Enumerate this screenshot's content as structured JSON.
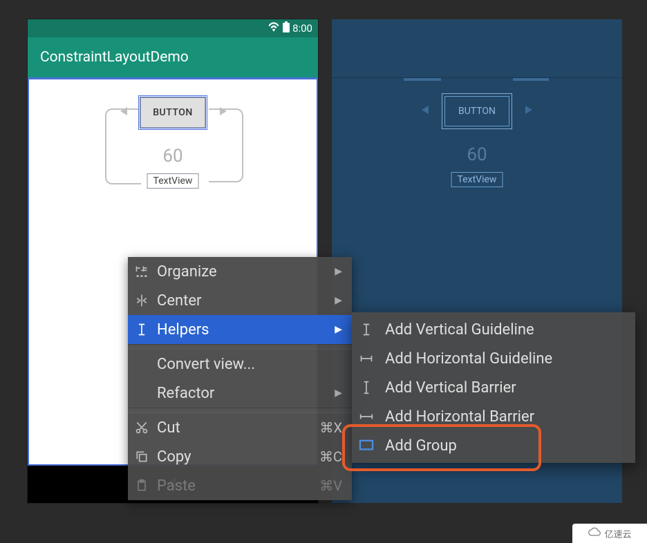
{
  "status": {
    "time": "8:00"
  },
  "app": {
    "title": "ConstraintLayoutDemo"
  },
  "widgets": {
    "button_label": "BUTTON",
    "margin": "60",
    "textview_label": "TextView"
  },
  "menu": {
    "organize": "Organize",
    "center": "Center",
    "helpers": "Helpers",
    "convert": "Convert view...",
    "refactor": "Refactor",
    "cut": "Cut",
    "cut_sc": "⌘X",
    "copy": "Copy",
    "copy_sc": "⌘C",
    "paste": "Paste",
    "paste_sc": "⌘V"
  },
  "submenu": {
    "add_vg": "Add Vertical Guideline",
    "add_hg": "Add Horizontal Guideline",
    "add_vb": "Add Vertical Barrier",
    "add_hb": "Add Horizontal Barrier",
    "add_group": "Add Group"
  },
  "watermark": "亿速云"
}
